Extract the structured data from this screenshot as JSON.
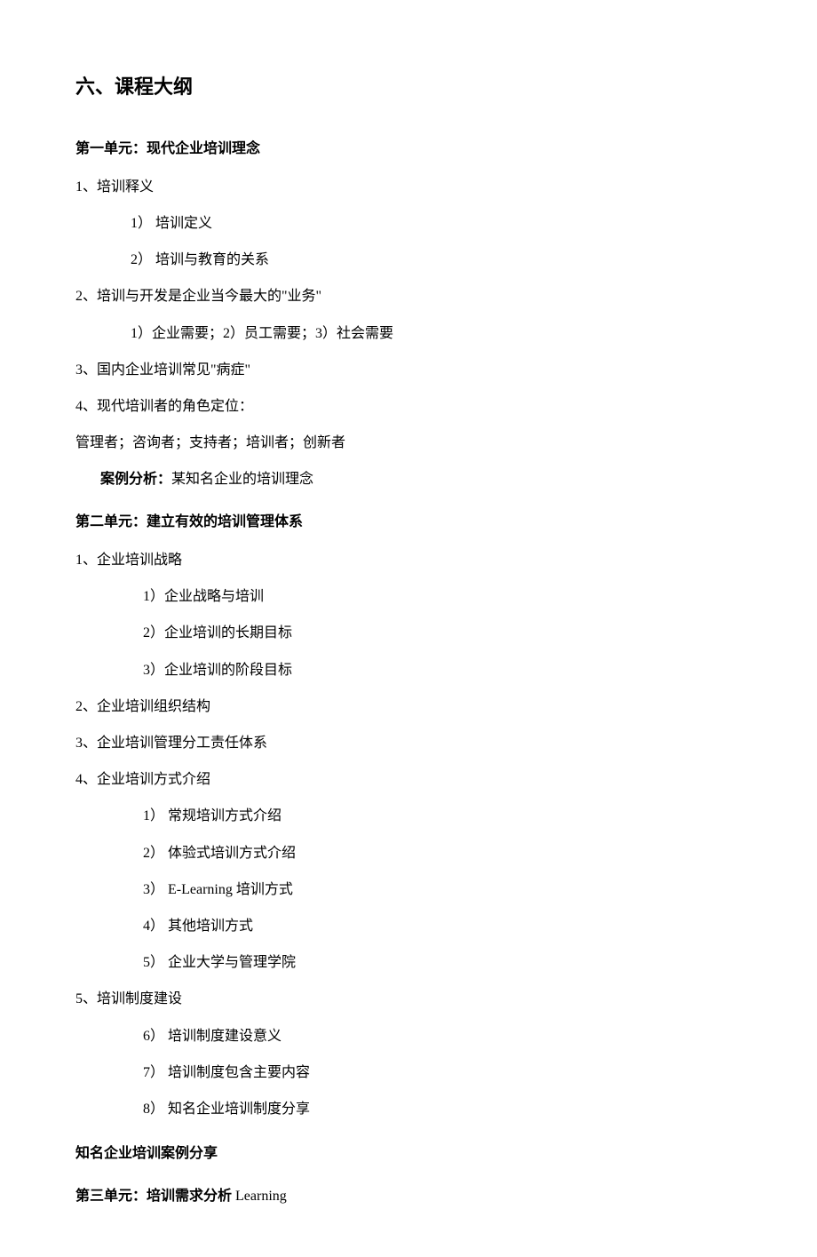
{
  "main_title": "六、课程大纲",
  "unit1": {
    "title": "第一单元：现代企业培训理念",
    "item1": "1、培训释义",
    "item1_sub1": "1）  培训定义",
    "item1_sub2": "2）  培训与教育的关系",
    "item2": "2、培训与开发是企业当今最大的\"业务\"",
    "item2_sub": "1）企业需要；2）员工需要；3）社会需要",
    "item3": "3、国内企业培训常见\"病症\"",
    "item4": "4、现代培训者的角色定位：",
    "item4_roles": "管理者；咨询者；支持者；培训者；创新者",
    "case_label": "案例分析：",
    "case_text": "某知名企业的培训理念"
  },
  "unit2": {
    "title": "第二单元：建立有效的培训管理体系",
    "item1": "1、企业培训战略",
    "item1_sub1": "1）企业战略与培训",
    "item1_sub2": "2）企业培训的长期目标",
    "item1_sub3": "3）企业培训的阶段目标",
    "item2": "2、企业培训组织结构",
    "item3": "3、企业培训管理分工责任体系",
    "item4": "4、企业培训方式介绍",
    "item4_sub1": "1） 常规培训方式介绍",
    "item4_sub2": "2） 体验式培训方式介绍",
    "item4_sub3": "3） E-Learning 培训方式",
    "item4_sub4": "4） 其他培训方式",
    "item4_sub5": "5） 企业大学与管理学院",
    "item5": "5、培训制度建设",
    "item5_sub6": "6） 培训制度建设意义",
    "item5_sub7": "7） 培训制度包含主要内容",
    "item5_sub8": "8） 知名企业培训制度分享"
  },
  "share_title": "知名企业培训案例分享",
  "unit3": {
    "title_prefix": "第三单元：培训需求分析",
    "title_suffix": " Learning"
  }
}
